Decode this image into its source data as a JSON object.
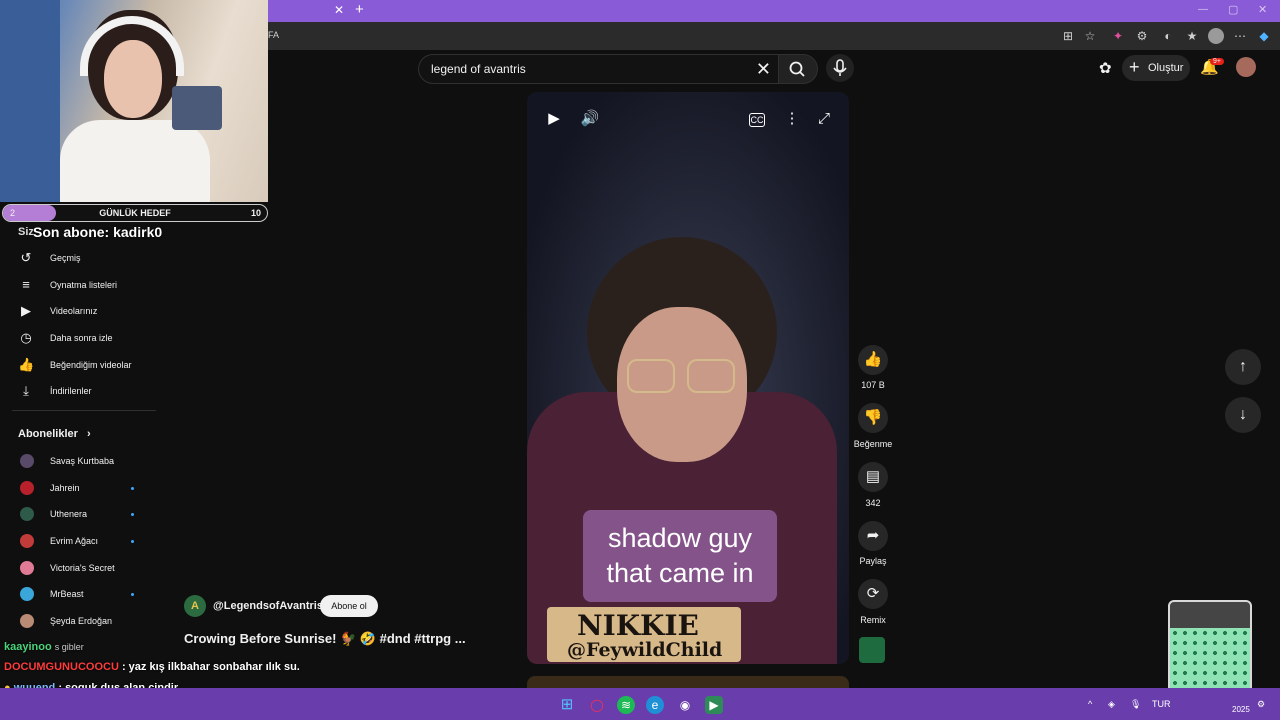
{
  "browser": {
    "address_fragment": "FA",
    "tab_close": "✕",
    "tab_new": "+"
  },
  "header": {
    "search": {
      "value": "legend of avantris"
    },
    "create_label": "Oluştur",
    "notifications_badge": "9+"
  },
  "stream_overlay": {
    "goal": {
      "start": "2",
      "label": "GÜNLÜK HEDEF",
      "target": "10",
      "progress_fraction": 0.2
    },
    "last_subscriber": "Son abone: kadirk0",
    "chat": [
      {
        "user": "kaayinoo",
        "message": "s gibler",
        "user_color": "#4bd37b"
      },
      {
        "user": "DOCUMGUNUCOOCU",
        "message": ": yaz kış ilkbahar sonbahar ılık su.",
        "user_color": "#ff3b3b"
      },
      {
        "user": "wuuend",
        "message": ": soguk dus alan cindir",
        "user_color": "#7fb8ff"
      }
    ]
  },
  "sidebar": {
    "you_label": "Siz",
    "items": [
      {
        "label": "Geçmiş",
        "icon": "history-icon"
      },
      {
        "label": "Oynatma listeleri",
        "icon": "playlist-icon"
      },
      {
        "label": "Videolarınız",
        "icon": "your-videos-icon"
      },
      {
        "label": "Daha sonra izle",
        "icon": "watch-later-icon"
      },
      {
        "label": "Beğendiğim videolar",
        "icon": "liked-icon"
      },
      {
        "label": "İndirilenler",
        "icon": "download-icon"
      }
    ],
    "subscriptions_heading": "Abonelikler",
    "subscriptions": [
      {
        "label": "Savaş Kurtbaba",
        "color": "#5a4a6a",
        "new": false
      },
      {
        "label": "Jahrein",
        "color": "#b8202c",
        "new": true
      },
      {
        "label": "Uthenera",
        "color": "#2e5a4a",
        "new": true
      },
      {
        "label": "Evrim Ağacı",
        "color": "#c23b3b",
        "new": true
      },
      {
        "label": "Victoria's Secret",
        "color": "#e07a95",
        "new": false
      },
      {
        "label": "MrBeast",
        "color": "#3aa6d9",
        "new": true
      },
      {
        "label": "Şeyda Erdoğan",
        "color": "#b98b74",
        "new": false
      }
    ]
  },
  "short": {
    "caption_line1": "shadow guy",
    "caption_line2": "that came in",
    "nameplate_name": "NIKKIE",
    "nameplate_handle": "@FeywildChild",
    "channel": "@LegendsofAvantris",
    "subscribe_label": "Abone ol",
    "title": "Crowing Before Sunrise! 🐓 🤣 #dnd #ttrpg ...",
    "actions": [
      {
        "icon": "like-icon",
        "label": "107 B"
      },
      {
        "icon": "dislike-icon",
        "label": "Beğenme"
      },
      {
        "icon": "comment-icon",
        "label": "342"
      },
      {
        "icon": "share-icon",
        "label": "Paylaş"
      },
      {
        "icon": "remix-icon",
        "label": "Remix"
      }
    ]
  },
  "taskbar": {
    "lang": "TUR",
    "year": "2025"
  }
}
